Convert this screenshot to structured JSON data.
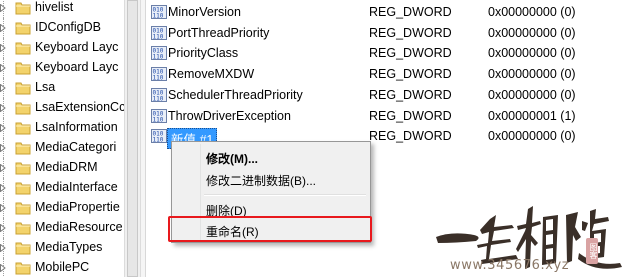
{
  "tree": {
    "items": [
      {
        "label": "hivelist"
      },
      {
        "label": "IDConfigDB"
      },
      {
        "label": "Keyboard Layc"
      },
      {
        "label": "Keyboard Layc"
      },
      {
        "label": "Lsa"
      },
      {
        "label": "LsaExtensionCc"
      },
      {
        "label": "LsaInformation"
      },
      {
        "label": "MediaCategori"
      },
      {
        "label": "MediaDRM"
      },
      {
        "label": "MediaInterface"
      },
      {
        "label": "MediaPropertie"
      },
      {
        "label": "MediaResource"
      },
      {
        "label": "MediaTypes"
      },
      {
        "label": "MobilePC"
      }
    ]
  },
  "values": {
    "rows": [
      {
        "name": "MinorVersion",
        "type": "REG_DWORD",
        "data": "0x00000000 (0)"
      },
      {
        "name": "PortThreadPriority",
        "type": "REG_DWORD",
        "data": "0x00000000 (0)"
      },
      {
        "name": "PriorityClass",
        "type": "REG_DWORD",
        "data": "0x00000000 (0)"
      },
      {
        "name": "RemoveMXDW",
        "type": "REG_DWORD",
        "data": "0x00000000 (0)"
      },
      {
        "name": "SchedulerThreadPriority",
        "type": "REG_DWORD",
        "data": "0x00000000 (0)"
      },
      {
        "name": "ThrowDriverException",
        "type": "REG_DWORD",
        "data": "0x00000001 (1)"
      },
      {
        "name": "新值 #1",
        "type": "REG_DWORD",
        "data": "0x00000000 (0)"
      }
    ]
  },
  "context_menu": {
    "modify": "修改(M)...",
    "modify_binary": "修改二进制数据(B)...",
    "delete": "删除(D)",
    "rename": "重命名(R)"
  },
  "watermark": {
    "brand": "一生相随",
    "url": "www.345676.xyz",
    "seal": "图客"
  },
  "colors": {
    "selection": "#3399ff",
    "highlight_box": "#e8191d",
    "menu_bg": "#f0f0f0"
  }
}
